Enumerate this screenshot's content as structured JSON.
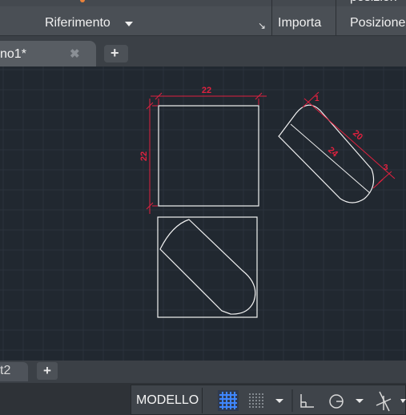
{
  "ribbon": {
    "panel_label": "Riferimento",
    "import_label": "Importa",
    "position_label": "Posizione",
    "position_top_fragment": "posizion"
  },
  "tabs": {
    "document_tab_label": "no1*",
    "close_glyph": "✖",
    "new_tab_glyph": "+"
  },
  "drawing": {
    "dim_top": "22",
    "dim_left": "22",
    "dim_small": "1",
    "dim_long": "20",
    "dim_slot": "24",
    "dim_end": "3"
  },
  "layout_tabs": {
    "tab_label": "t2",
    "add_glyph": "+"
  },
  "statusbar": {
    "model_label": "MODELLO"
  },
  "colors": {
    "canvas_bg": "#212830",
    "grid_line": "#2c3440",
    "geometry": "#f2f2f2",
    "dimension": "#e0213f",
    "grid_icon": "#3f86ff"
  }
}
